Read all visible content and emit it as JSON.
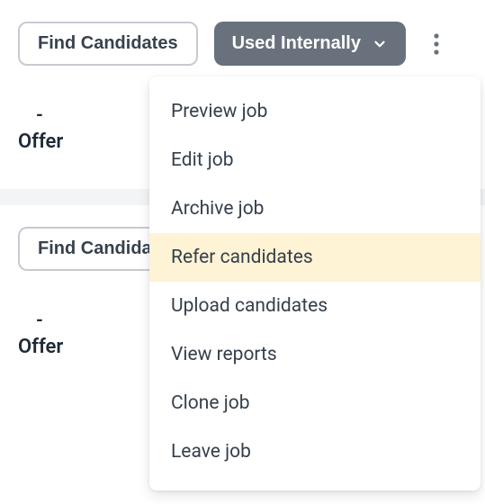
{
  "section1": {
    "find_btn": "Find Candidates",
    "status_btn": "Used Internally",
    "stat_value": "-",
    "stat_label": "Offer"
  },
  "section2": {
    "find_btn": "Find Candidates",
    "stat_value": "-",
    "stat_label": "Offer"
  },
  "dropdown": {
    "items": [
      {
        "label": "Preview job",
        "highlight": false
      },
      {
        "label": "Edit job",
        "highlight": false
      },
      {
        "label": "Archive job",
        "highlight": false
      },
      {
        "label": "Refer candidates",
        "highlight": true
      },
      {
        "label": "Upload candidates",
        "highlight": false
      },
      {
        "label": "View reports",
        "highlight": false
      },
      {
        "label": "Clone job",
        "highlight": false
      },
      {
        "label": "Leave job",
        "highlight": false
      }
    ]
  }
}
